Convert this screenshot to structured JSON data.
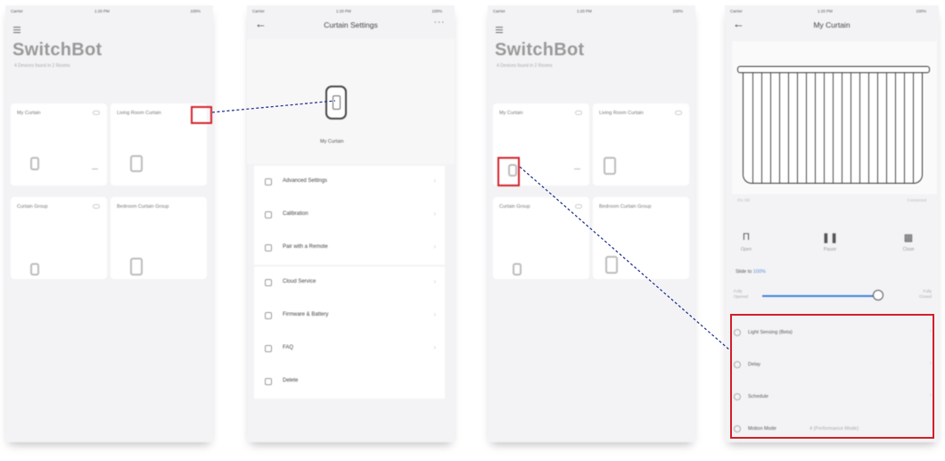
{
  "status_bar": {
    "left": "Carrier",
    "time": "1:20 PM",
    "battery": "100%"
  },
  "home": {
    "brand": "SwitchBot",
    "subtitle": "4 Devices found in 2 Rooms",
    "cards": [
      {
        "name": "My Curtain"
      },
      {
        "name": "Living Room Curtain"
      },
      {
        "name": "Curtain Group"
      },
      {
        "name": "Bedroom Curtain Group"
      }
    ]
  },
  "settings": {
    "title": "Curtain Settings",
    "device_label": "My Curtain",
    "menu_group_1": [
      {
        "label": "Advanced Settings",
        "icon": "gear-icon"
      },
      {
        "label": "Calibration",
        "icon": "calibration-icon"
      },
      {
        "label": "Pair with a Remote",
        "icon": "remote-icon"
      }
    ],
    "menu_group_2": [
      {
        "label": "Cloud Service",
        "icon": "cloud-icon"
      },
      {
        "label": "Firmware & Battery",
        "icon": "battery-icon"
      },
      {
        "label": "FAQ",
        "icon": "question-icon"
      },
      {
        "label": "Delete",
        "icon": "trash-icon"
      }
    ]
  },
  "curtain": {
    "title": "My Curtain",
    "position_text": "0% Slit",
    "connection": "Connected",
    "controls": [
      {
        "label": "Open",
        "icon": "open-icon"
      },
      {
        "label": "Pause",
        "icon": "pause-icon"
      },
      {
        "label": "Close",
        "icon": "close-curtain-icon"
      }
    ],
    "slide_prefix": "Slide to ",
    "slide_value": "100%",
    "slider_level": 1.0,
    "fully_opened": "Fully Opened",
    "fully_closed": "Fully Closed",
    "options": [
      {
        "label": "Light Sensing (Beta)",
        "value": ""
      },
      {
        "label": "Delay",
        "value": ""
      },
      {
        "label": "Schedule",
        "value": ""
      },
      {
        "label": "Motion Mode",
        "value": "4 (Performance Mode)"
      }
    ]
  },
  "colors": {
    "highlight": "#d21f2a",
    "connector": "#2b3a93",
    "slider": "#3d7edb"
  }
}
